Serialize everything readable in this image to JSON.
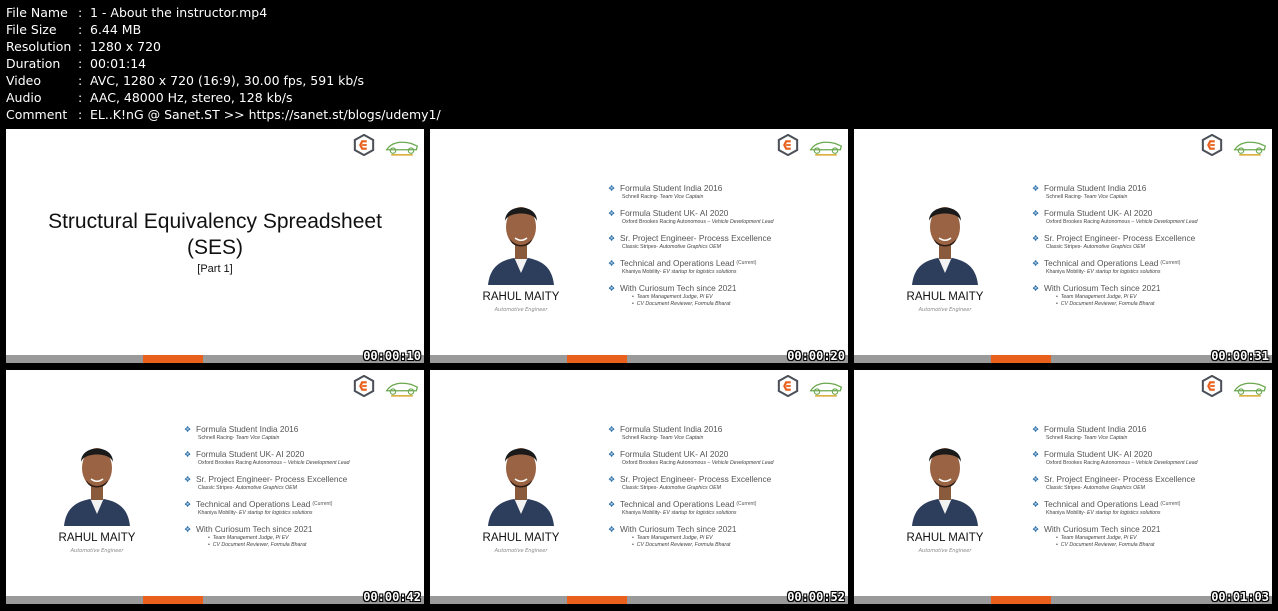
{
  "info": [
    {
      "key": "File Name",
      "value": "1 - About the instructor.mp4"
    },
    {
      "key": "File Size",
      "value": "6.44 MB"
    },
    {
      "key": "Resolution",
      "value": "1280 x 720"
    },
    {
      "key": "Duration",
      "value": "00:01:14"
    },
    {
      "key": "Video",
      "value": "AVC, 1280 x 720 (16:9), 30.00 fps, 591 kb/s"
    },
    {
      "key": "Audio",
      "value": "AAC, 48000 Hz, stereo, 128 kb/s"
    },
    {
      "key": "Comment",
      "value": "EL..K!nG @ Sanet.ST >> https://sanet.st/blogs/udemy1/"
    }
  ],
  "title_slide": {
    "title_line1": "Structural Equivalency Spreadsheet",
    "title_line2": "(SES)",
    "subtitle": "[Part 1]"
  },
  "profile": {
    "name": "RAHUL MAITY",
    "role": "Automotive Engineer",
    "items": [
      {
        "title": "Formula Student India 2016",
        "tag": "",
        "org": "Schnell Racing- ",
        "detail": "Team Vice Captain"
      },
      {
        "title": "Formula Student UK- AI 2020",
        "tag": "",
        "org": "Oxford Brookes Racing Autonomous – ",
        "detail": "Vehicle Development Lead"
      },
      {
        "title": "Sr. Project Engineer- Process Excellence",
        "tag": "",
        "org": "Classic Stripes- ",
        "detail": "Automotive Graphics OEM"
      },
      {
        "title": "Technical and Operations Lead",
        "tag": "(Current)",
        "org": "Khaniya Mobility- ",
        "detail": "EV startup for logistics solutions"
      },
      {
        "title": "With Curiosum Tech since 2021",
        "tag": "",
        "org": "",
        "detail": ""
      }
    ],
    "sub_bullets": [
      "Team Management Judge, Pi EV",
      "CV Document Reviewer, Formula Bharat"
    ]
  },
  "timestamps": [
    "00:00:10",
    "00:00:20",
    "00:00:31",
    "00:00:42",
    "00:00:52",
    "00:01:03"
  ],
  "colors": {
    "accent": "#e8601c",
    "bar": "#9a9a9a",
    "bullet": "#2b6fa8"
  }
}
